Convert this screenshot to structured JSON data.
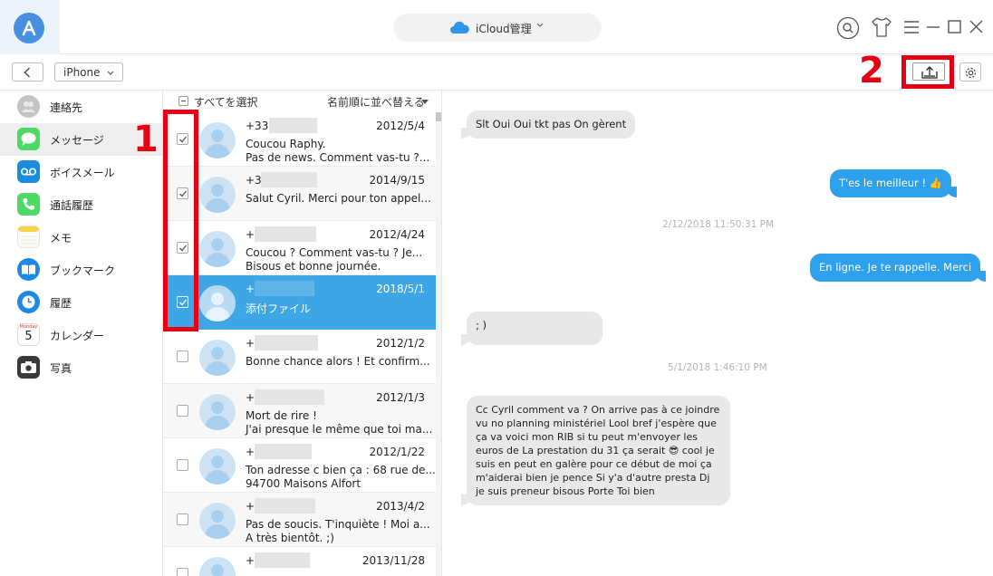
{
  "app": {
    "title": "iCloud管理",
    "device": "iPhone"
  },
  "annotations": {
    "step1": "1",
    "step2": "2"
  },
  "sidebar": {
    "items": [
      {
        "label": "連絡先",
        "icon": "contacts-icon",
        "color": "#b9b9b9"
      },
      {
        "label": "メッセージ",
        "icon": "messages-icon",
        "color": "#4cd964",
        "active": true
      },
      {
        "label": "ボイスメール",
        "icon": "voicemail-icon",
        "color": "#1a8ce0"
      },
      {
        "label": "通話履歴",
        "icon": "phone-icon",
        "color": "#4cd964"
      },
      {
        "label": "メモ",
        "icon": "notes-icon",
        "color": "#f7d24a"
      },
      {
        "label": "ブックマーク",
        "icon": "bookmark-icon",
        "color": "#1e88e5"
      },
      {
        "label": "履歴",
        "icon": "history-icon",
        "color": "#1e88e5"
      },
      {
        "label": "カレンダー",
        "icon": "calendar-icon",
        "color": "#ffffff",
        "day": "5",
        "month": "Monday"
      },
      {
        "label": "写真",
        "icon": "camera-icon",
        "color": "#333333"
      }
    ]
  },
  "list": {
    "select_all": "すべてを選択",
    "sort_label": "名前順に並べ替える",
    "rows": [
      {
        "number": "+336",
        "date": "2012/5/4",
        "line1": "Coucou Raphy.",
        "line2": "Pas de news. Comment vas-tu ?...",
        "checked": true
      },
      {
        "number": "+33",
        "date": "2014/9/15",
        "line1": "Salut Cyril. Merci pour ton appel...",
        "line2": "",
        "checked": true
      },
      {
        "number": "+3",
        "date": "2012/4/24",
        "line1": "Coucou ? Comment vas-tu ? Je...",
        "line2": "Bisous et bonne journée.",
        "checked": true
      },
      {
        "number": "+3",
        "date": "2018/5/1",
        "line1": "添付ファイル",
        "line2": "",
        "checked": true,
        "selected": true
      },
      {
        "number": "+3",
        "date": "2012/1/2",
        "line1": "Bonne chance alors ! Et confirm...",
        "line2": "",
        "checked": false
      },
      {
        "number": "+3",
        "date": "2012/1/3",
        "line1": "Mort de rire !",
        "line2": "J'ai presque le même que toi ma...",
        "checked": false
      },
      {
        "number": "+3",
        "date": "2012/1/22",
        "line1": "Ton adresse c bien ça : 68 rue de...",
        "line2": "94700 Maisons Alfort",
        "checked": false
      },
      {
        "number": "+3",
        "date": "2013/4/2",
        "line1": "Pas de soucis. T'inquiète ! Moi a...",
        "line2": "A très bientôt. ;)",
        "checked": false
      },
      {
        "number": "+3",
        "date": "2013/11/28",
        "line1": "",
        "line2": "",
        "checked": false
      }
    ]
  },
  "conversation": {
    "messages": [
      {
        "dir": "in",
        "text": "Slt Oui Oui tkt pas On gèrent"
      },
      {
        "dir": "out",
        "text": "T'es le meilleur ! 👍"
      },
      {
        "dir": "ts",
        "text": "2/12/2018 11:50:31 PM"
      },
      {
        "dir": "out",
        "text": "En ligne. Je te rappelle. Merci"
      },
      {
        "dir": "in",
        "text": "; )"
      },
      {
        "dir": "ts",
        "text": "5/1/2018 1:46:10 PM"
      },
      {
        "dir": "in",
        "text": "Cc Cyril comment va ? On arrive pas à ce joindre vu no planning ministériel Lool bref j'espère que ça va voici mon RIB si tu peut m'envoyer les euros de La prestation du 31 ça serait 😎 cool je suis en peut en galère pour ce début de moi ça m'aiderai bien je pence Si y'a d'autre presta Dj je suis preneur bisous Porte Toi bien"
      }
    ]
  },
  "colors": {
    "accent": "#3ea6e4",
    "outgoing_bubble": "#2ea0ec",
    "incoming_bubble": "#e8e8e8",
    "highlight": "#e60012"
  }
}
